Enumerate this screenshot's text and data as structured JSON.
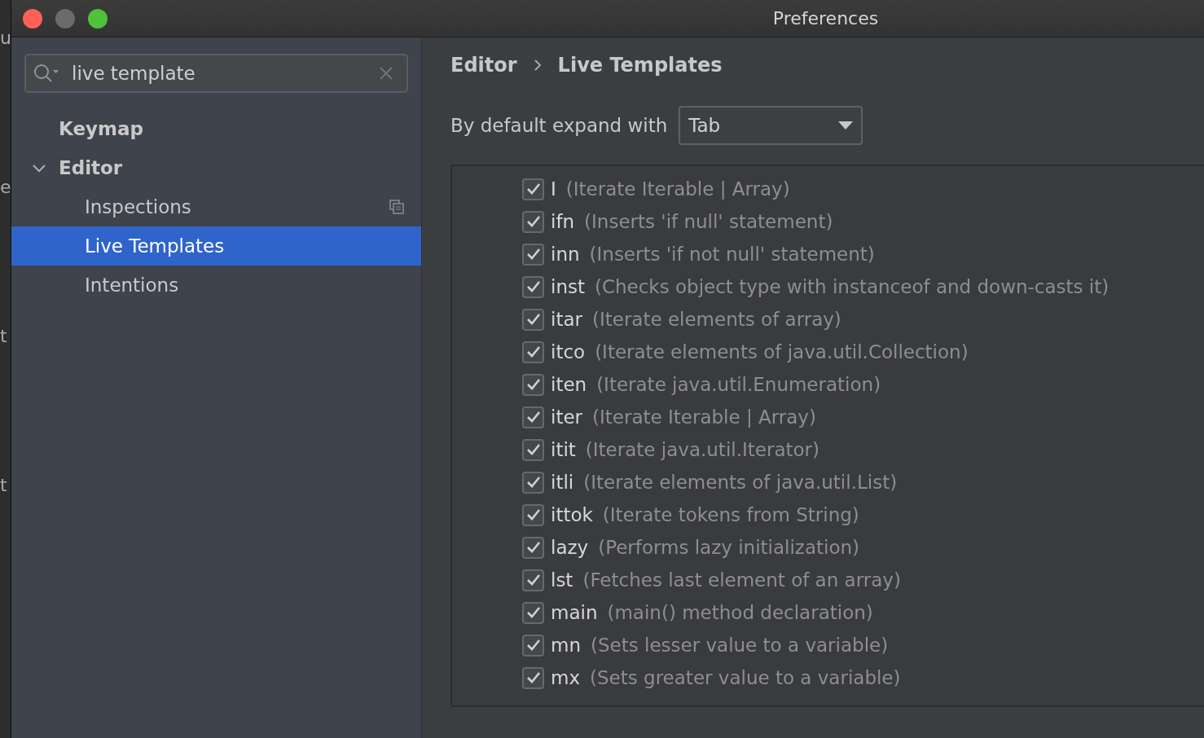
{
  "background_window": {
    "fragments": [
      "u",
      "e",
      "t",
      "t"
    ]
  },
  "window": {
    "title": "Preferences"
  },
  "search": {
    "value": "live template"
  },
  "sidebar": {
    "items": [
      {
        "label": "Keymap",
        "selected": false
      },
      {
        "label": "Editor",
        "expanded": true,
        "selected": false,
        "children": [
          {
            "label": "Inspections",
            "selected": false,
            "has_copy_icon": true
          },
          {
            "label": "Live Templates",
            "selected": true,
            "has_copy_icon": false
          },
          {
            "label": "Intentions",
            "selected": false,
            "has_copy_icon": false
          }
        ]
      }
    ]
  },
  "breadcrumb": [
    "Editor",
    "Live Templates"
  ],
  "expand_with": {
    "label": "By default expand with",
    "value": "Tab"
  },
  "templates": [
    {
      "abbr": "I",
      "description": "(Iterate Iterable | Array)",
      "checked": true
    },
    {
      "abbr": "ifn",
      "description": "(Inserts 'if null' statement)",
      "checked": true
    },
    {
      "abbr": "inn",
      "description": "(Inserts 'if not null' statement)",
      "checked": true
    },
    {
      "abbr": "inst",
      "description": "(Checks object type with instanceof and down-casts it)",
      "checked": true
    },
    {
      "abbr": "itar",
      "description": "(Iterate elements of array)",
      "checked": true
    },
    {
      "abbr": "itco",
      "description": "(Iterate elements of java.util.Collection)",
      "checked": true
    },
    {
      "abbr": "iten",
      "description": "(Iterate java.util.Enumeration)",
      "checked": true
    },
    {
      "abbr": "iter",
      "description": "(Iterate Iterable | Array)",
      "checked": true
    },
    {
      "abbr": "itit",
      "description": "(Iterate java.util.Iterator)",
      "checked": true
    },
    {
      "abbr": "itli",
      "description": "(Iterate elements of java.util.List)",
      "checked": true
    },
    {
      "abbr": "ittok",
      "description": "(Iterate tokens from String)",
      "checked": true
    },
    {
      "abbr": "lazy",
      "description": "(Performs lazy initialization)",
      "checked": true
    },
    {
      "abbr": "lst",
      "description": "(Fetches last element of an array)",
      "checked": true
    },
    {
      "abbr": "main",
      "description": "(main() method declaration)",
      "checked": true
    },
    {
      "abbr": "mn",
      "description": "(Sets lesser value to a variable)",
      "checked": true
    },
    {
      "abbr": "mx",
      "description": "(Sets greater value to a variable)",
      "checked": true
    }
  ]
}
